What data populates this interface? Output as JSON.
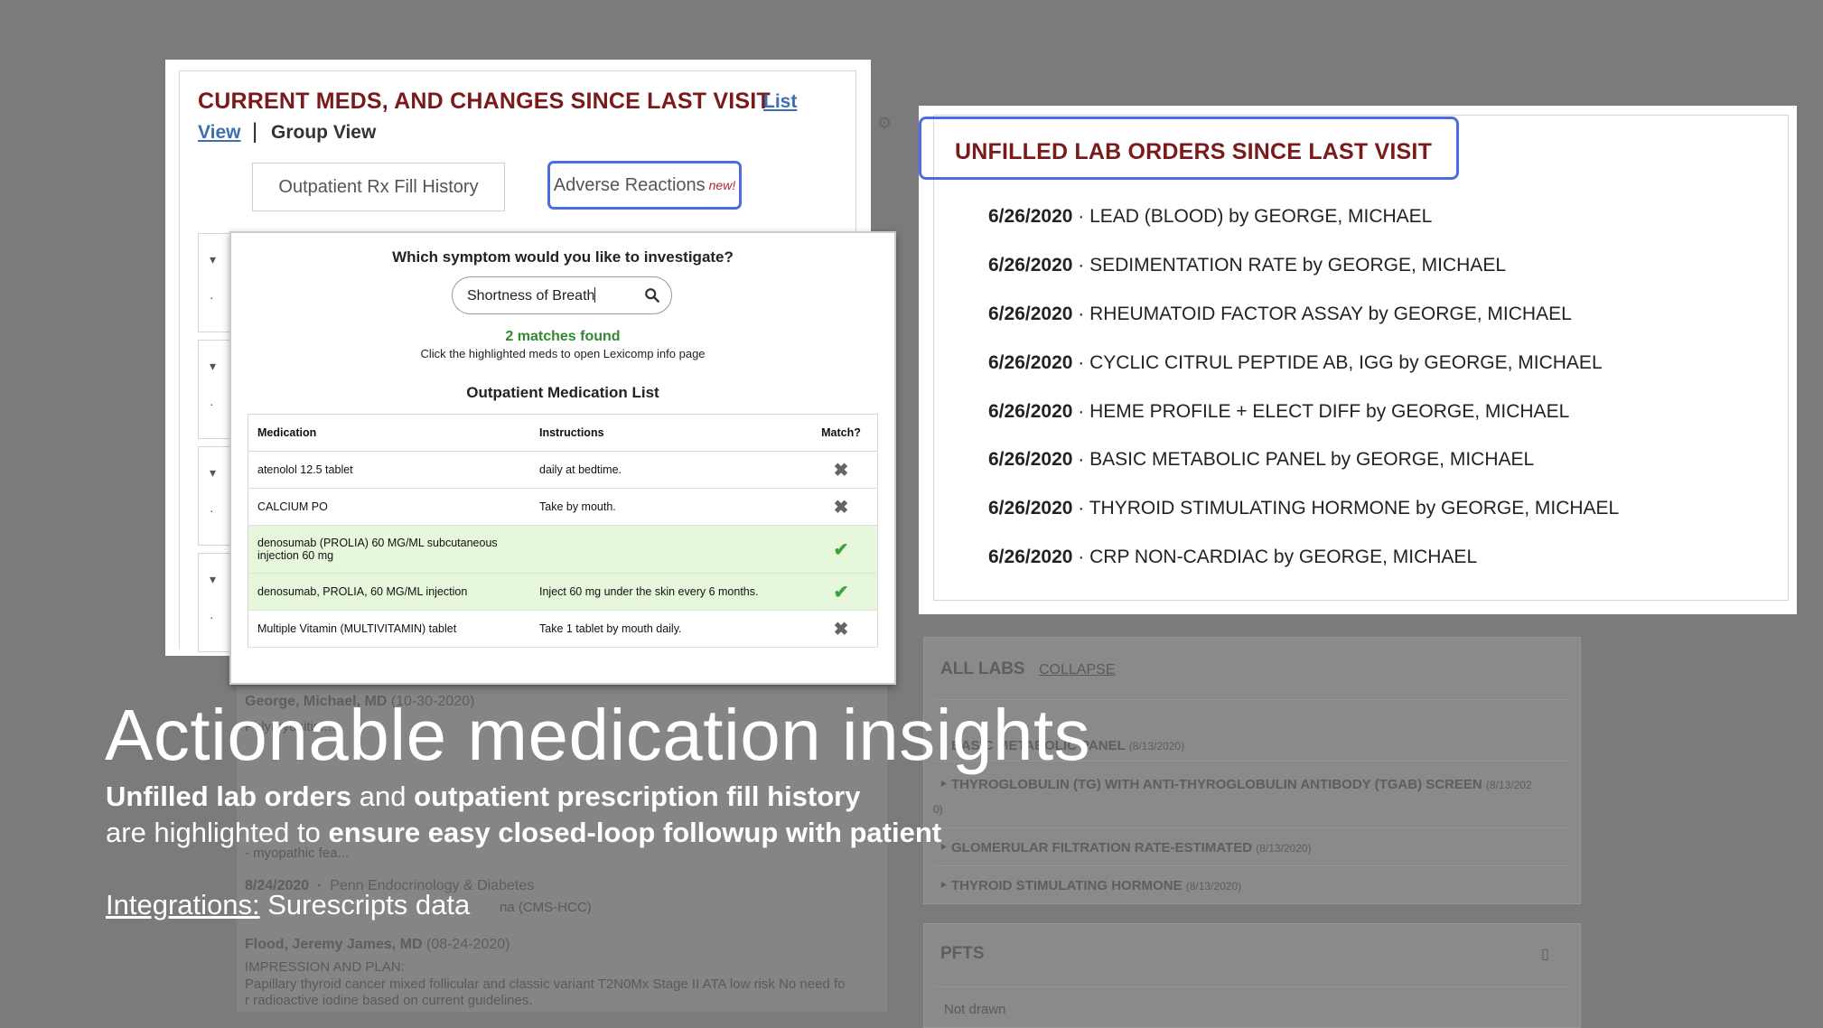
{
  "background": {
    "notes": [
      {
        "author": "George, Michael, MD",
        "date": "(10-30-2020)"
      },
      {
        "text": "Polymyositis...."
      },
      {
        "text": "- myopathic fea..."
      },
      {
        "author": "8/24/2020",
        "extra": "Penn Endocrinology & Diabetes"
      },
      {
        "text": "na (CMS-HCC)"
      },
      {
        "author": "Flood, Jeremy James, MD",
        "date": "(08-24-2020)"
      },
      {
        "text": "IMPRESSION AND PLAN:"
      },
      {
        "text": "Papillary thyroid cancer mixed follicular and classic variant T2N0Mx Stage II ATA low risk No need fo"
      },
      {
        "text": "r radioactive iodine based on current guidelines."
      }
    ],
    "all_labs": {
      "title": "ALL LABS",
      "collapse": "COLLAPSE",
      "rows": [
        {
          "name": "BASIC METABOLIC PANEL",
          "date": "(8/13/2020)"
        },
        {
          "name": "THYROGLOBULIN (TG) WITH ANTI-THYROGLOBULIN ANTIBODY (TGAB) SCREEN",
          "date": "(8/13/202"
        },
        {
          "name": "0)",
          "date": ""
        },
        {
          "name": "GLOMERULAR FILTRATION RATE-ESTIMATED",
          "date": "(8/13/2020)"
        },
        {
          "name": "THYROID STIMULATING HORMONE",
          "date": "(8/13/2020)"
        }
      ]
    },
    "pfts": {
      "title": "PFTS",
      "body": "Not drawn"
    }
  },
  "meds_panel": {
    "title": "CURRENT MEDS, AND CHANGES SINCE LAST VISIT",
    "list_link": "List",
    "view_link": "View",
    "separator": "|",
    "group_view": "Group View",
    "tab_rx": "Outpatient Rx Fill History",
    "tab_adverse": "Adverse Reactions",
    "tab_adverse_badge": "new!"
  },
  "symptom_popup": {
    "question": "Which symptom would you like to investigate?",
    "search_value": "Shortness of Breath",
    "matches": "2 matches found",
    "matches_hint": "Click the highlighted meds to open Lexicomp info page",
    "list_title": "Outpatient Medication List",
    "columns": [
      "Medication",
      "Instructions",
      "Match?"
    ],
    "rows": [
      {
        "medication": "atenolol 12.5 tablet",
        "instructions": "daily at bedtime.",
        "match": false
      },
      {
        "medication": "CALCIUM PO",
        "instructions": "Take by mouth.",
        "match": false
      },
      {
        "medication": "denosumab (PROLIA) 60 MG/ML subcutaneous injection 60 mg",
        "instructions": "",
        "match": true
      },
      {
        "medication": "denosumab, PROLIA, 60 MG/ML injection",
        "instructions": "Inject 60 mg under the skin every 6 months.",
        "match": true
      },
      {
        "medication": "Multiple Vitamin (MULTIVITAMIN) tablet",
        "instructions": "Take 1 tablet by mouth daily.",
        "match": false
      }
    ],
    "mark_yes": "✔",
    "mark_no": "✖"
  },
  "lab_orders": {
    "title": "UNFILLED LAB ORDERS SINCE LAST VISIT",
    "rows": [
      {
        "date": "6/26/2020",
        "text": "· LEAD (BLOOD) by GEORGE, MICHAEL"
      },
      {
        "date": "6/26/2020",
        "text": "· SEDIMENTATION RATE by GEORGE, MICHAEL"
      },
      {
        "date": "6/26/2020",
        "text": "· RHEUMATOID FACTOR ASSAY by GEORGE, MICHAEL"
      },
      {
        "date": "6/26/2020",
        "text": "· CYCLIC CITRUL PEPTIDE AB, IGG by GEORGE, MICHAEL"
      },
      {
        "date": "6/26/2020",
        "text": "· HEME PROFILE + ELECT DIFF by GEORGE, MICHAEL"
      },
      {
        "date": "6/26/2020",
        "text": "· BASIC METABOLIC PANEL by GEORGE, MICHAEL"
      },
      {
        "date": "6/26/2020",
        "text": "· THYROID STIMULATING HORMONE by GEORGE, MICHAEL"
      },
      {
        "date": "6/26/2020",
        "text": "· CRP NON-CARDIAC by GEORGE, MICHAEL"
      }
    ]
  },
  "caption": {
    "headline": "Actionable medication insights",
    "line1_a": "Unfilled lab orders",
    "line1_b": " and ",
    "line1_c": "outpatient prescription fill history",
    "line2_a": "are highlighted to ",
    "line2_b": "ensure easy closed-loop followup with patient",
    "integrations_label": "Integrations:",
    "integrations_value": " Surescripts data"
  },
  "colors": {
    "accent_blue": "#4a6de5",
    "title_red": "#7b1a1a",
    "match_green": "#2f8a2f",
    "match_row_bg": "#e6f7dc",
    "backdrop": "#7b7b7b"
  }
}
